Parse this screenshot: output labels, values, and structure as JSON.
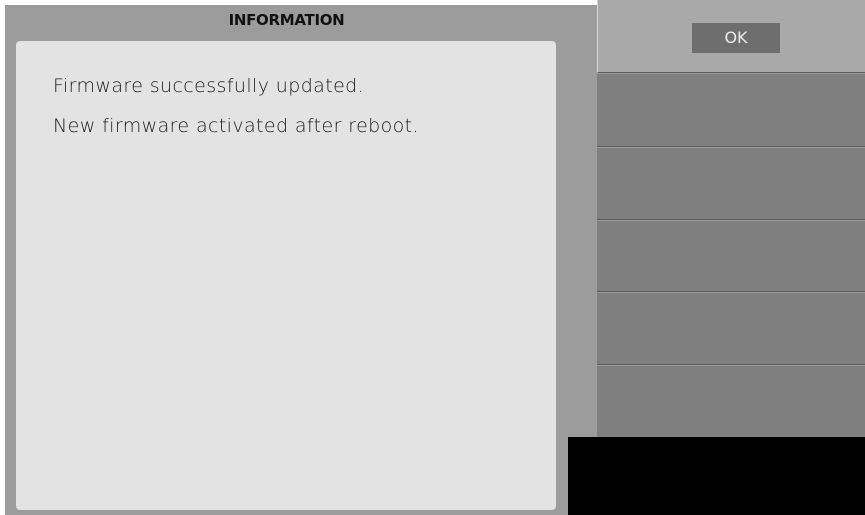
{
  "dialog": {
    "title": "INFORMATION",
    "messages": [
      "Firmware successfully updated.",
      "New firmware activated after reboot."
    ]
  },
  "softkeys": {
    "ok_label": "OK"
  },
  "colors": {
    "frame": "#9c9c9c",
    "message_background": "#e3e3e3",
    "softkey": "#7f7f7f",
    "ok_slot": "#a9a9a9",
    "ok_button": "#6e6e6e",
    "black_area": "#000000"
  }
}
